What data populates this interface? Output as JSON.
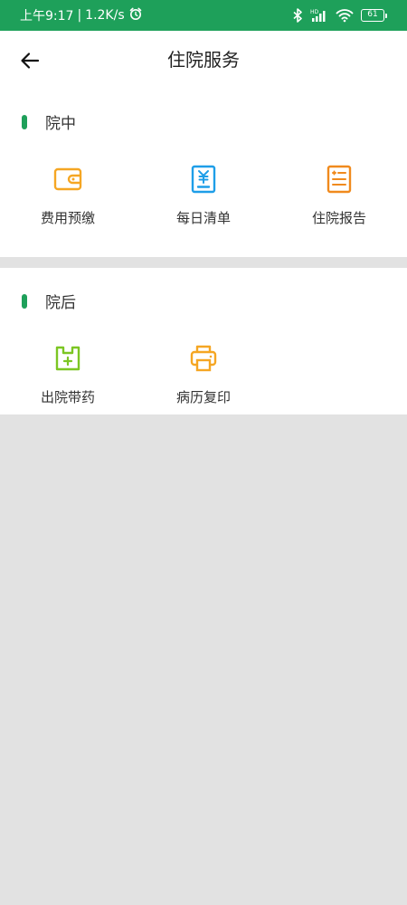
{
  "status_bar": {
    "time": "上午9:17",
    "separator": "|",
    "speed": "1.2K/s",
    "battery": "61"
  },
  "header": {
    "title": "住院服务"
  },
  "sections": {
    "during": {
      "title": "院中",
      "items": [
        {
          "label": "费用预缴",
          "icon": "wallet-icon",
          "color": "#f5a623"
        },
        {
          "label": "每日清单",
          "icon": "yuan-bill-icon",
          "color": "#1e9ee8"
        },
        {
          "label": "住院报告",
          "icon": "report-icon",
          "color": "#f08a1d"
        }
      ]
    },
    "after": {
      "title": "院后",
      "items": [
        {
          "label": "出院带药",
          "icon": "medicine-bag-icon",
          "color": "#7cc623"
        },
        {
          "label": "病历复印",
          "icon": "printer-icon",
          "color": "#f5a623"
        }
      ]
    }
  },
  "colors": {
    "brand": "#1ea05a",
    "background": "#e2e2e2"
  }
}
